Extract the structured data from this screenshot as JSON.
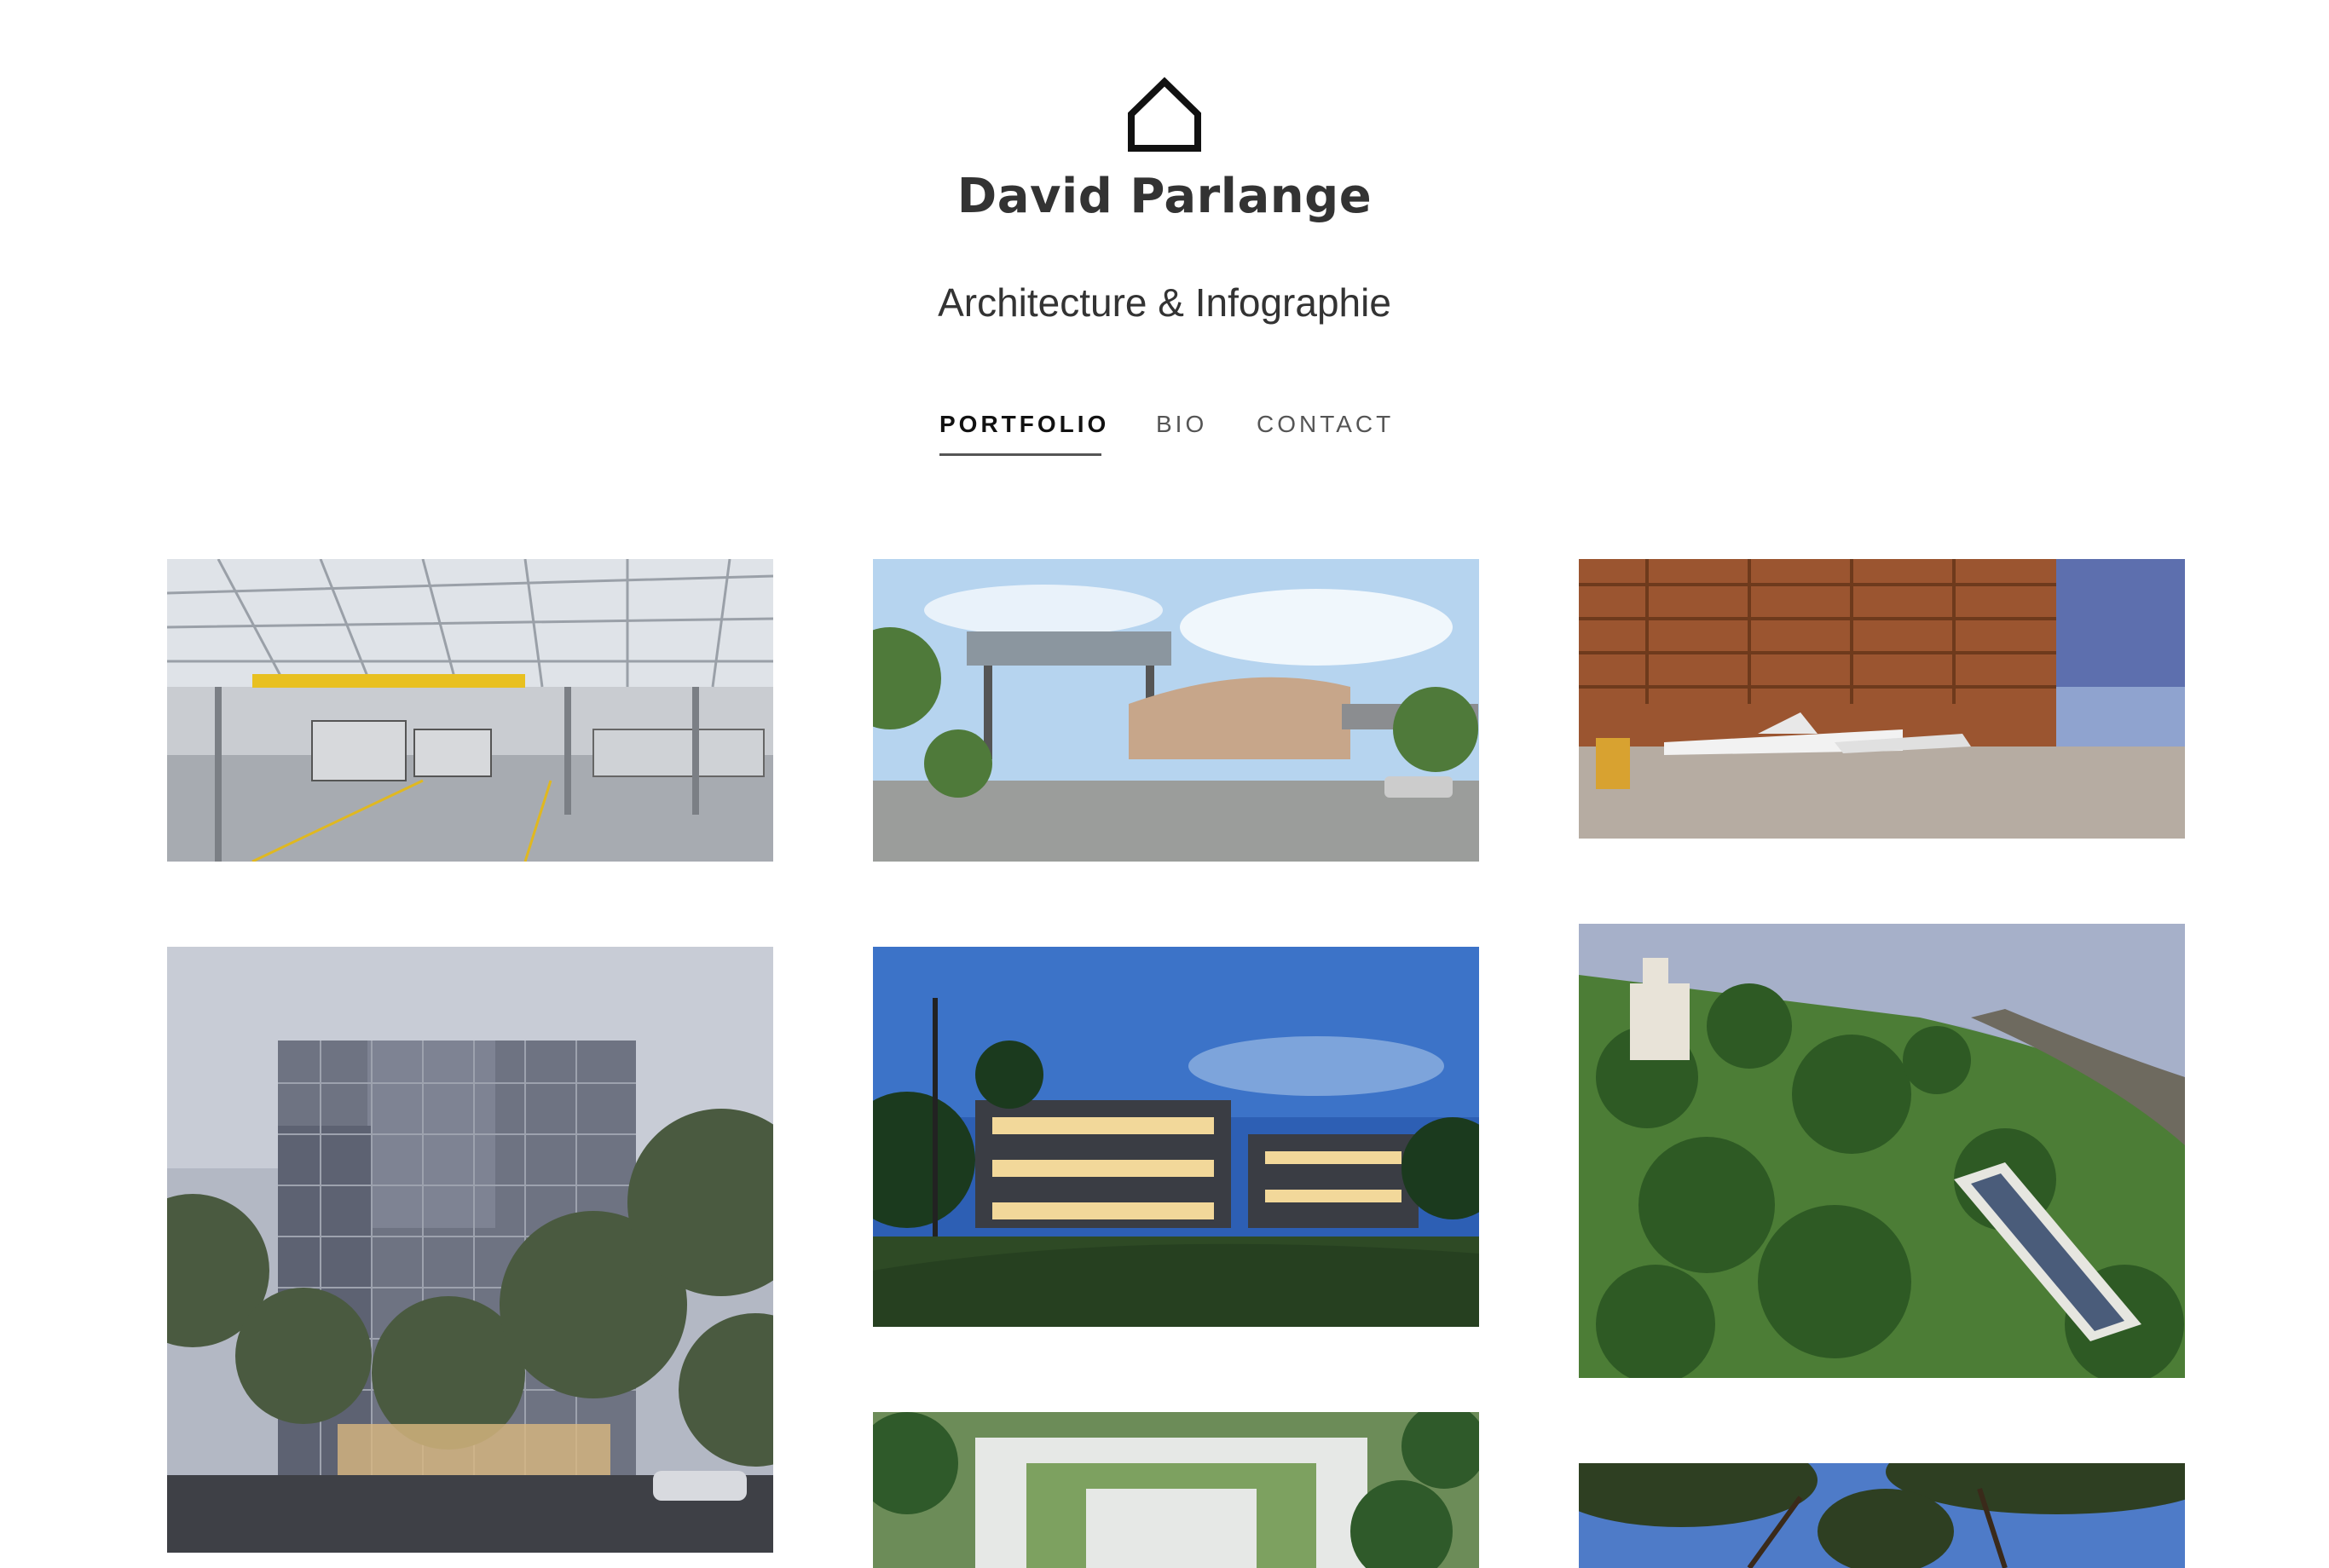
{
  "site": {
    "logo_icon": "house-outline-icon",
    "title": "David Parlange",
    "tagline": "Architecture & Infographie"
  },
  "nav": {
    "items": [
      {
        "label": "PORTFOLIO",
        "active": true
      },
      {
        "label": "BIO",
        "active": false
      },
      {
        "label": "CONTACT",
        "active": false
      }
    ]
  },
  "portfolio": {
    "tiles": [
      {
        "subject": "tram depot interior with trams under steel roof"
      },
      {
        "subject": "modern building with solar canopy and palm trees"
      },
      {
        "subject": "aircraft hangar with private jets"
      },
      {
        "subject": "glass office building with trees at dusk"
      },
      {
        "subject": "office building at night with street lamps"
      },
      {
        "subject": "aerial view of seaside villa with pool"
      },
      {
        "subject": "aerial view of building with green roofs"
      },
      {
        "subject": "pine trees against blue sky"
      }
    ]
  }
}
